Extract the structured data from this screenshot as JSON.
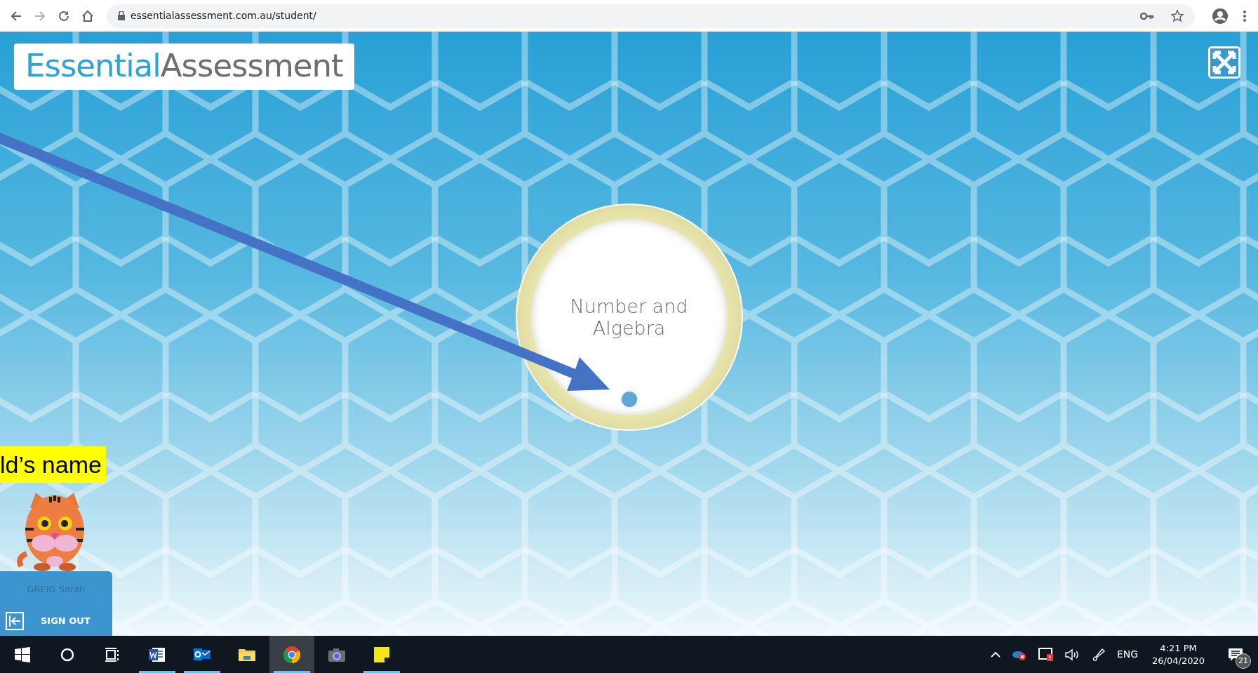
{
  "browser": {
    "url": "essentialassessment.com.au/student/"
  },
  "logo": {
    "part_1": "Essential",
    "part_2": "Assessment"
  },
  "topic": {
    "title": "Number and Algebra"
  },
  "annotation": {
    "label": "ld’s name"
  },
  "student": {
    "name": "GREIG Sarah",
    "sign_out": "SIGN OUT"
  },
  "taskbar": {
    "apps": [
      {
        "kind": "word",
        "running": true,
        "selected": false
      },
      {
        "kind": "outlook",
        "running": true,
        "selected": false
      },
      {
        "kind": "explorer",
        "running": false,
        "selected": false
      },
      {
        "kind": "chrome",
        "running": true,
        "selected": true
      },
      {
        "kind": "camera",
        "running": false,
        "selected": false
      },
      {
        "kind": "sticky",
        "running": true,
        "selected": false
      }
    ],
    "tray": {
      "language": "ENG",
      "time": "4:21 PM",
      "date": "26/04/2020",
      "notifications": "21"
    }
  }
}
